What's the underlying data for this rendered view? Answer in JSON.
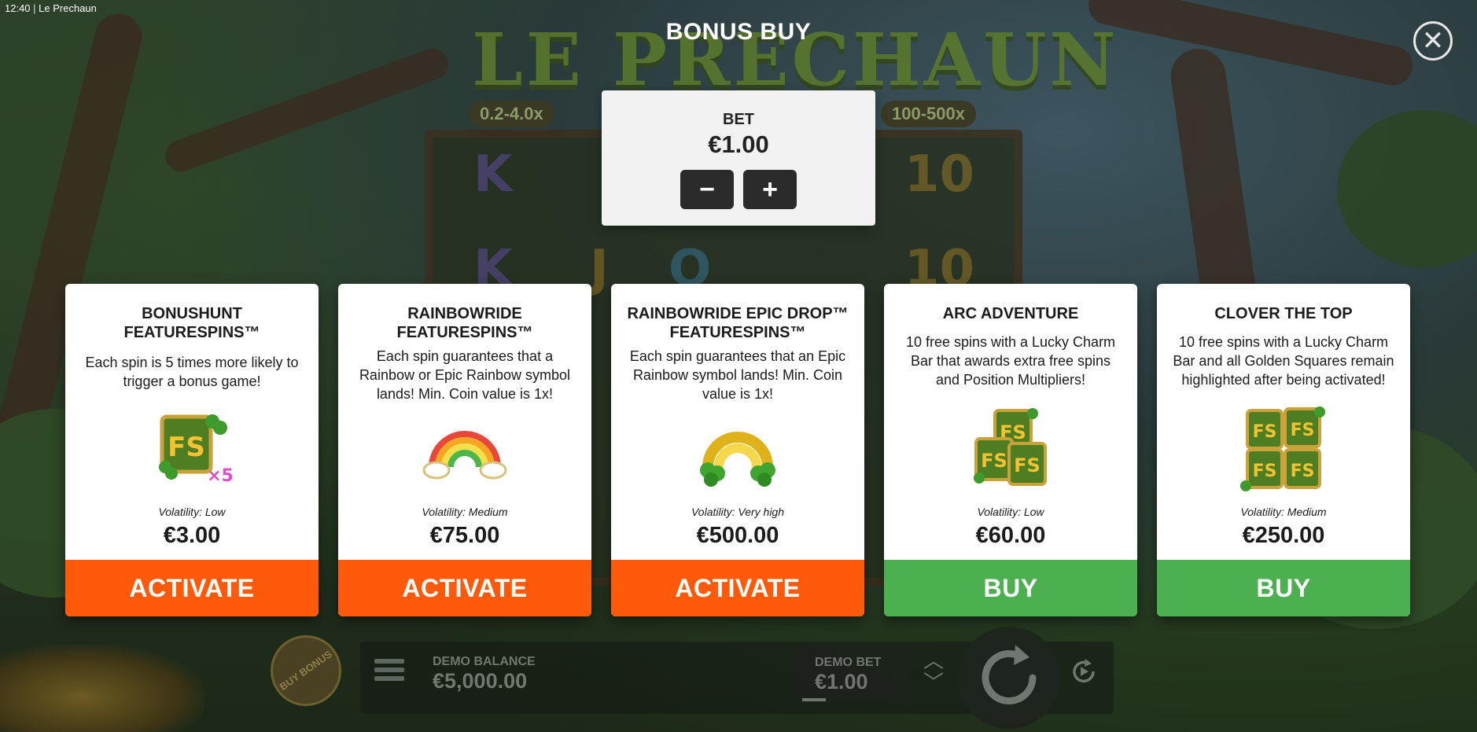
{
  "status_bar": {
    "time": "12:40",
    "app_title": "Le Prechaun"
  },
  "modal": {
    "title": "BONUS BUY"
  },
  "bet": {
    "label": "BET",
    "value": "€1.00",
    "minus_symbol": "−",
    "plus_symbol": "+"
  },
  "cards": [
    {
      "title_line1": "BONUSHUNT",
      "title_line2": "FEATURESPINS™",
      "description": "Each spin is 5 times more likely to trigger a bonus game!",
      "volatility": "Volatility: Low",
      "price": "€3.00",
      "button": "ACTIVATE",
      "icon": "fs-x5-icon"
    },
    {
      "title_line1": "RAINBOWRIDE",
      "title_line2": "FEATURESPINS™",
      "description": "Each spin guarantees that a Rainbow or Epic Rainbow symbol lands! Min. Coin value is 1x!",
      "volatility": "Volatility: Medium",
      "price": "€75.00",
      "button": "ACTIVATE",
      "icon": "rainbow-icon"
    },
    {
      "title_line1": "RAINBOWRIDE EPIC DROP™",
      "title_line2": "FEATURESPINS™",
      "description": "Each spin guarantees that an Epic Rainbow symbol lands! Min. Coin value is 1x!",
      "volatility": "Volatility: Very high",
      "price": "€500.00",
      "button": "ACTIVATE",
      "icon": "golden-rainbow-icon"
    },
    {
      "title_line1": "ARC ADVENTURE",
      "title_line2": "",
      "description": "10 free spins with a Lucky Charm Bar that awards extra free spins and Position Multipliers!",
      "volatility": "Volatility: Low",
      "price": "€60.00",
      "button": "BUY",
      "icon": "fs-triple-icon"
    },
    {
      "title_line1": "CLOVER THE TOP",
      "title_line2": "",
      "description": "10 free spins with a Lucky Charm Bar and all Golden Squares remain highlighted after being activated!",
      "volatility": "Volatility: Medium",
      "price": "€250.00",
      "button": "BUY",
      "icon": "fs-quad-icon"
    }
  ],
  "background": {
    "logo": "LE PRECHAUN",
    "multiplier_left": "0.2-4.0x",
    "multiplier_right": "100-500x"
  },
  "bottom_bar": {
    "buy_bonus": "BUY BONUS",
    "balance_label": "DEMO BALANCE",
    "balance_value": "€5,000.00",
    "bet_label": "DEMO BET",
    "bet_value": "€1.00"
  },
  "colors": {
    "activate": "#ff5a0a",
    "buy": "#4caf50",
    "card_bg": "#ffffff",
    "bet_panel_bg": "#f2f2f2"
  }
}
